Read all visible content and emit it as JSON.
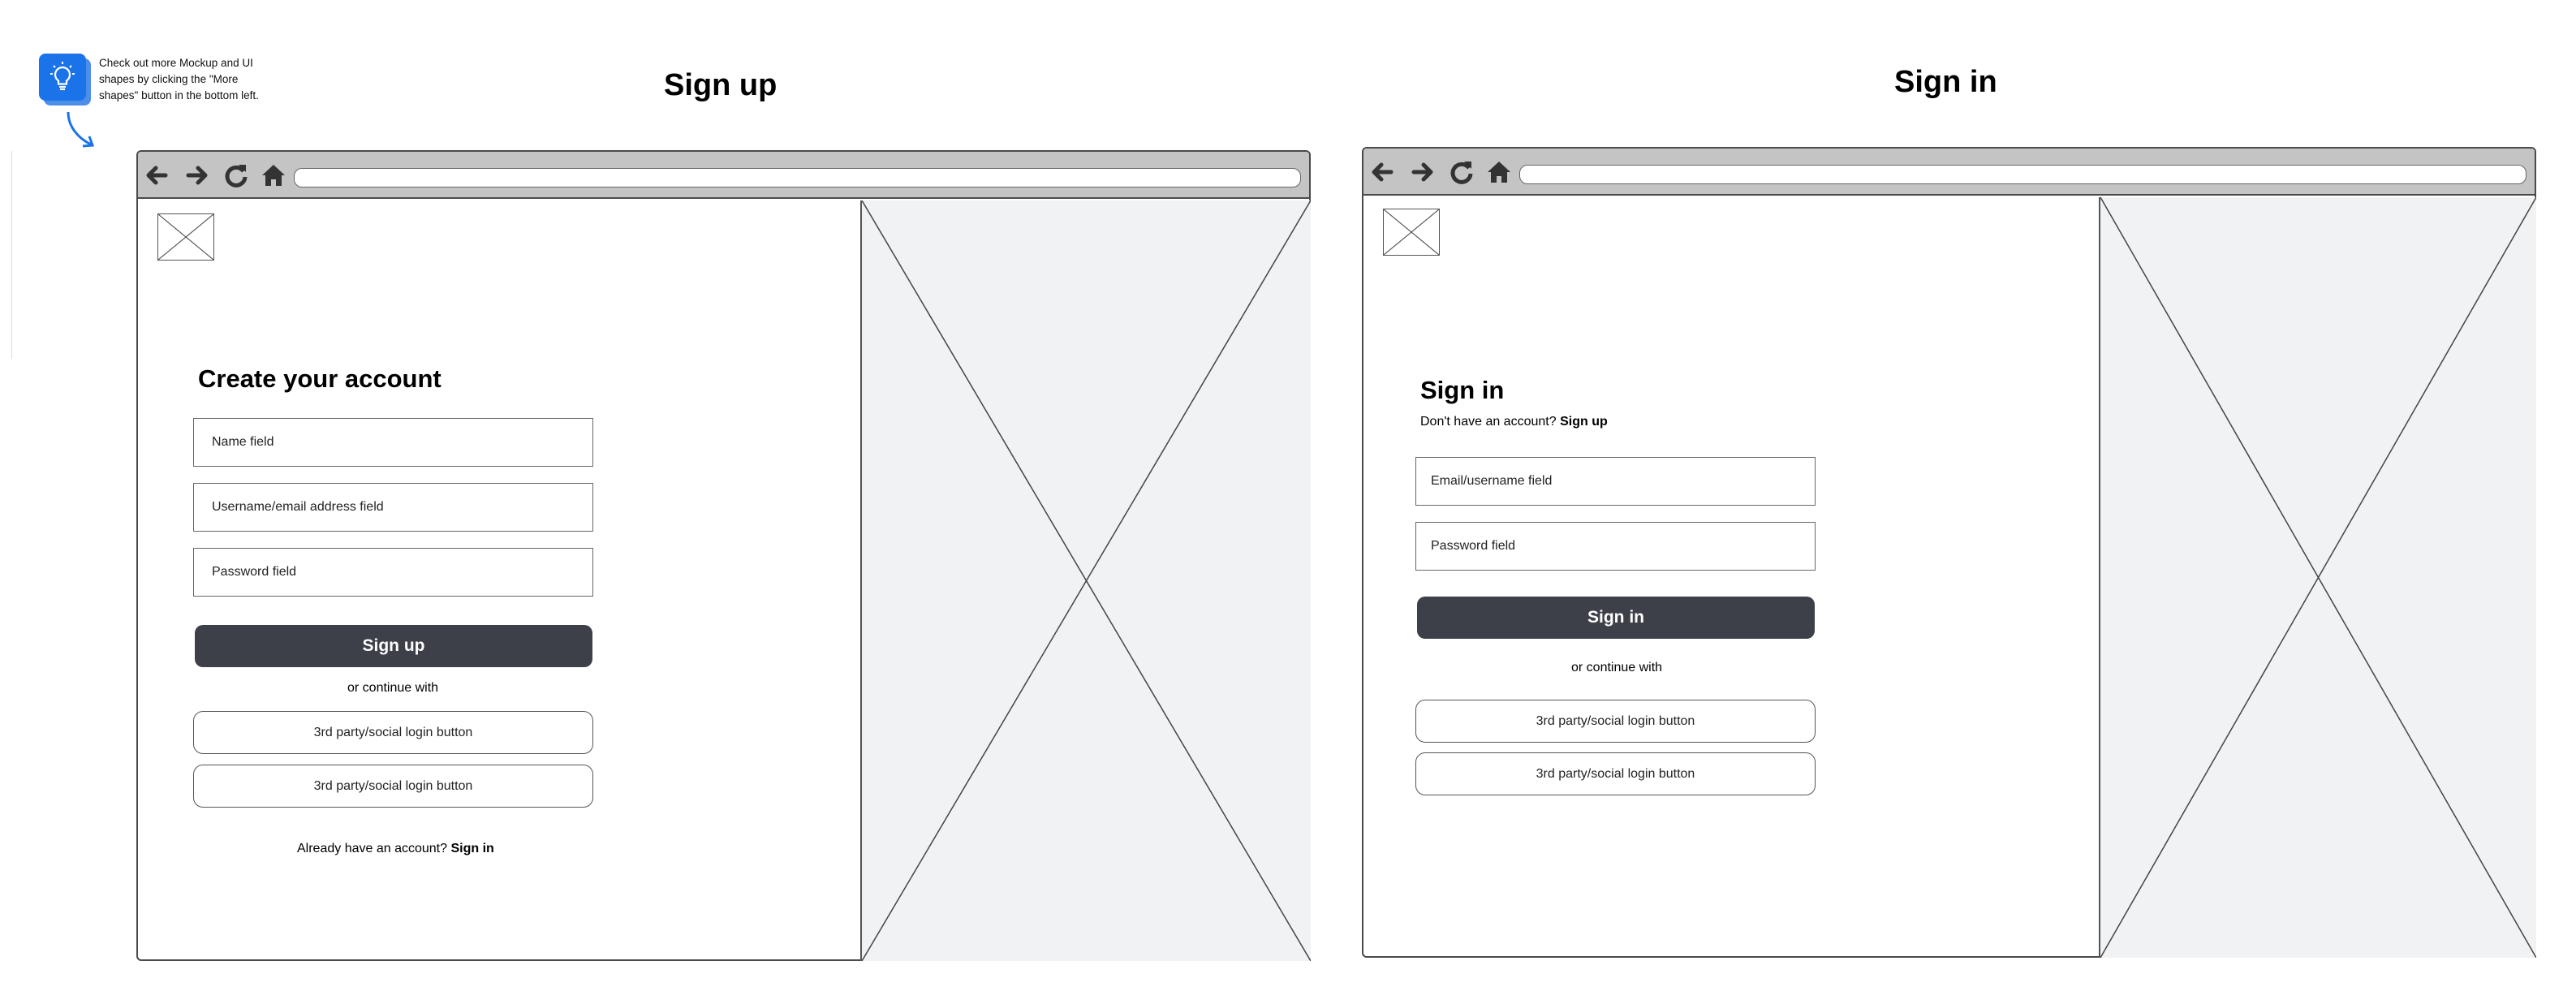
{
  "tip": {
    "text": "Check out more Mockup and UI shapes by clicking the \"More shapes\" button in the bottom left.",
    "icon": "lightbulb-icon",
    "accent": "#1a73e8"
  },
  "signup": {
    "section_title": "Sign up",
    "heading": "Create your account",
    "fields": [
      {
        "label": "Name field"
      },
      {
        "label": "Username/email address field"
      },
      {
        "label": "Password field"
      }
    ],
    "submit_label": "Sign up",
    "continue_text": "or continue with",
    "social_buttons": [
      {
        "label": "3rd party/social login button"
      },
      {
        "label": "3rd party/social login button"
      }
    ],
    "footer_prompt": "Already have an account?",
    "footer_link": "Sign in"
  },
  "signin": {
    "section_title": "Sign in",
    "heading": "Sign in",
    "prompt": "Don't have an account?",
    "prompt_link": "Sign up",
    "fields": [
      {
        "label": "Email/username field"
      },
      {
        "label": "Password field"
      }
    ],
    "submit_label": "Sign in",
    "continue_text": "or continue with",
    "social_buttons": [
      {
        "label": "3rd party/social login button"
      },
      {
        "label": "3rd party/social login button"
      }
    ]
  },
  "browser": {
    "nav_icons": [
      "back-arrow-icon",
      "forward-arrow-icon",
      "reload-icon",
      "home-icon"
    ],
    "toolbar_color": "#c4c4c4",
    "button_color": "#3d4049",
    "placeholder_fill": "#f1f2f4"
  }
}
